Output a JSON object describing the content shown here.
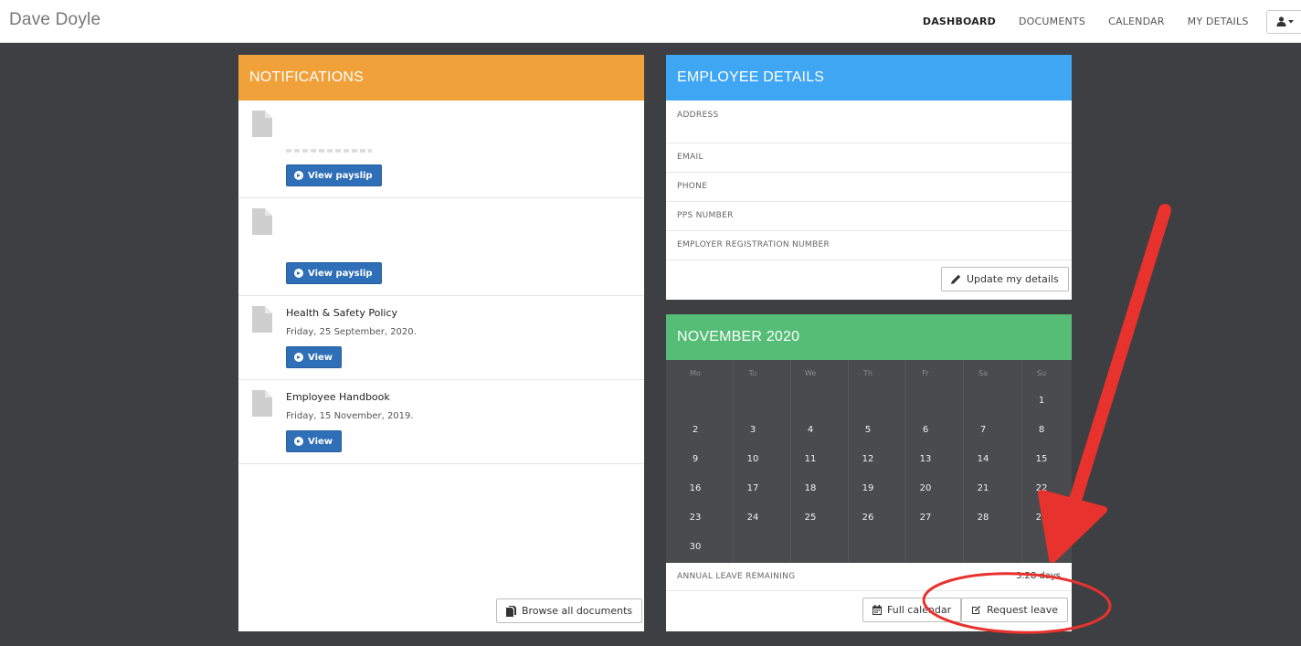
{
  "navbar": {
    "brand": "Dave Doyle",
    "items": [
      {
        "label": "DASHBOARD",
        "active": true
      },
      {
        "label": "DOCUMENTS",
        "active": false
      },
      {
        "label": "CALENDAR",
        "active": false
      },
      {
        "label": "MY DETAILS",
        "active": false
      }
    ],
    "user_icon": "user-icon"
  },
  "notifications": {
    "title": "NOTIFICATIONS",
    "items": [
      {
        "title": "",
        "date": "",
        "button": "View payslip"
      },
      {
        "title": "",
        "date": "",
        "button": "View payslip"
      },
      {
        "title": "Health & Safety Policy",
        "date": "Friday, 25 September, 2020.",
        "button": "View"
      },
      {
        "title": "Employee Handbook",
        "date": "Friday, 15 November, 2019.",
        "button": "View"
      }
    ],
    "browse_button": "Browse all documents"
  },
  "employee": {
    "title": "EMPLOYEE DETAILS",
    "fields": [
      {
        "label": "ADDRESS",
        "value": ""
      },
      {
        "label": "EMAIL",
        "value": ""
      },
      {
        "label": "PHONE",
        "value": ""
      },
      {
        "label": "PPS NUMBER",
        "value": ""
      },
      {
        "label": "EMPLOYER REGISTRATION NUMBER",
        "value": ""
      }
    ],
    "update_button": "Update my details"
  },
  "calendar": {
    "title": "NOVEMBER 2020",
    "weekdays": [
      "Mo",
      "Tu",
      "We",
      "Th",
      "Fr",
      "Sa",
      "Su"
    ],
    "weeks": [
      [
        "",
        "",
        "",
        "",
        "",
        "",
        "1"
      ],
      [
        "2",
        "3",
        "4",
        "5",
        "6",
        "7",
        "8"
      ],
      [
        "9",
        "10",
        "11",
        "12",
        "13",
        "14",
        "15"
      ],
      [
        "16",
        "17",
        "18",
        "19",
        "20",
        "21",
        "22"
      ],
      [
        "23",
        "24",
        "25",
        "26",
        "27",
        "28",
        "29"
      ],
      [
        "30",
        "",
        "",
        "",
        "",
        "",
        ""
      ]
    ],
    "leave_label": "ANNUAL LEAVE REMAINING",
    "leave_value": "3.28 days",
    "full_calendar_button": "Full calendar",
    "request_leave_button": "Request leave"
  },
  "colors": {
    "notifications_header": "#f0a13a",
    "employee_header": "#3ea6f2",
    "calendar_header": "#55bd75",
    "primary_button": "#2e6fb7",
    "annotation": "#e8322d"
  }
}
